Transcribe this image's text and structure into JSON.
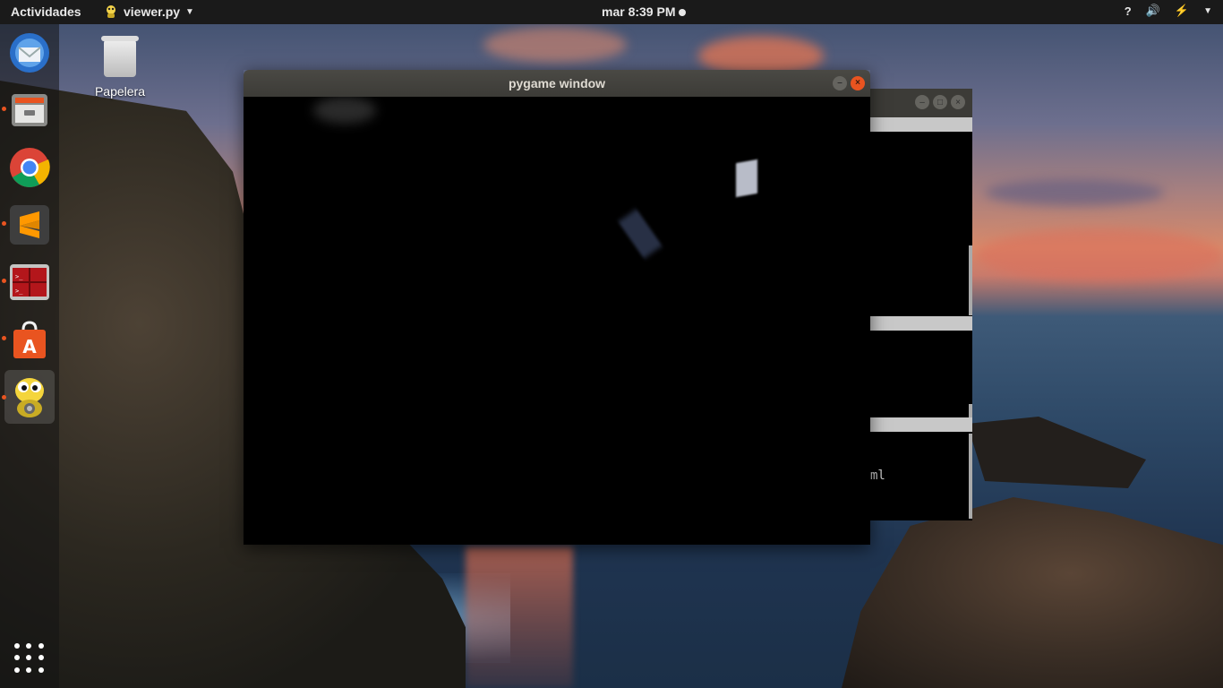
{
  "topbar": {
    "activities": "Actividades",
    "app_name": "viewer.py",
    "clock": "mar  8:39 PM",
    "help": "?",
    "volume": "🔊",
    "power": "⚡"
  },
  "dock": {
    "items": [
      {
        "name": "thunderbird",
        "icon": "mail-icon"
      },
      {
        "name": "files",
        "icon": "file-cabinet-icon"
      },
      {
        "name": "chrome",
        "icon": "chrome-icon"
      },
      {
        "name": "sublime-text",
        "icon": "sublime-icon"
      },
      {
        "name": "terminal",
        "icon": "terminal-icon"
      },
      {
        "name": "software",
        "icon": "software-bag-icon"
      },
      {
        "name": "python",
        "icon": "python-snake-icon"
      }
    ]
  },
  "desktop": {
    "trash_label": "Papelera"
  },
  "pygame_window": {
    "title": "pygame window"
  },
  "background_window": {
    "visible_text": "ml"
  },
  "colors": {
    "accent": "#e95420",
    "titlebar": "#3c3b37",
    "topbar": "#1a1a1a"
  }
}
